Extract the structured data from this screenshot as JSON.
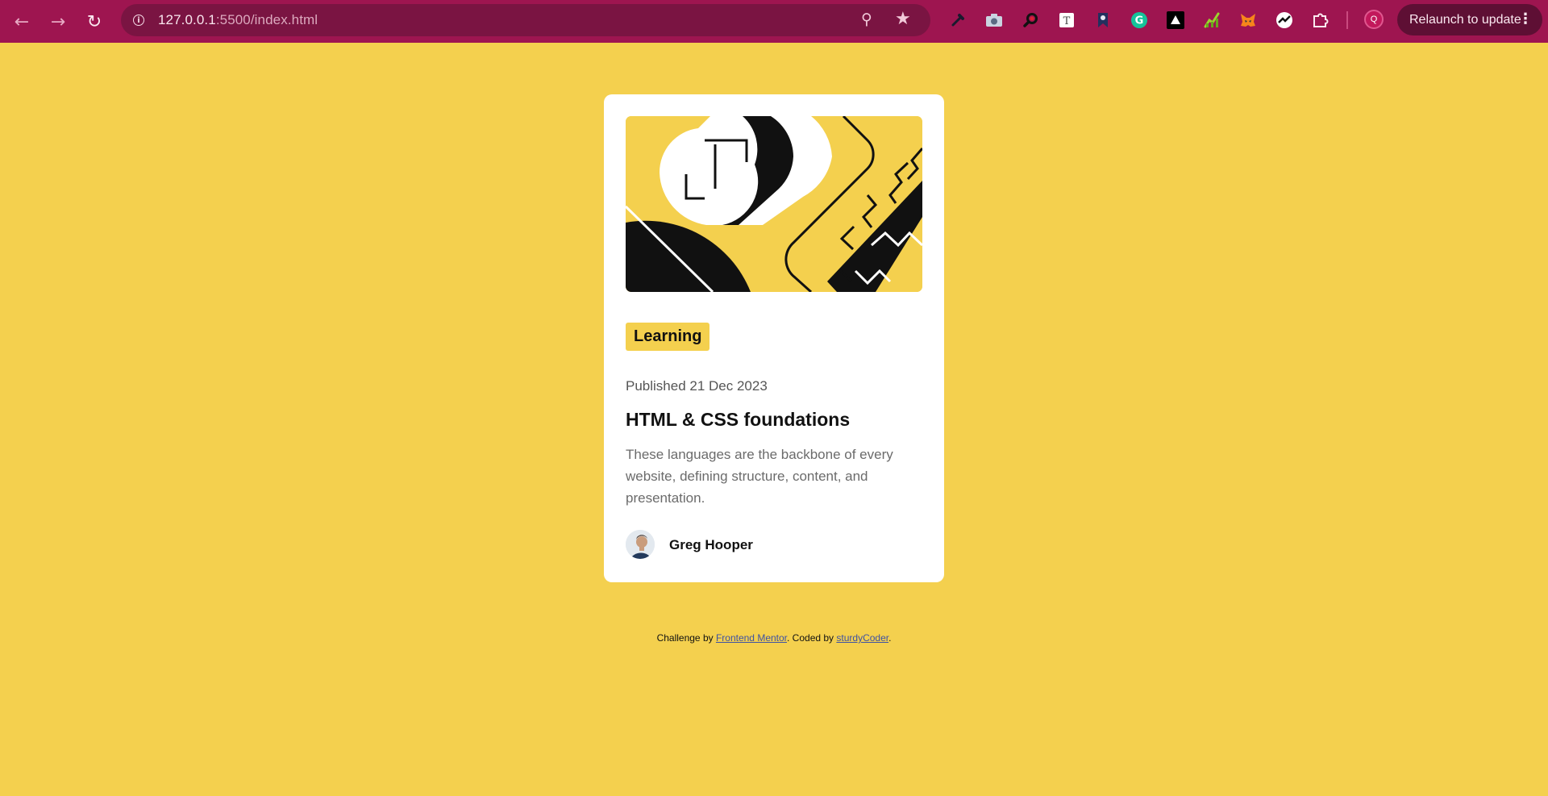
{
  "browser": {
    "url_host": "127.0.0.1",
    "url_rest": ":5500/index.html",
    "relaunch_label": "Relaunch to update",
    "profile_initial": "Q",
    "extensions": [
      "eyedropper-icon",
      "camera-icon",
      "magnifier-icon",
      "text-extension-icon",
      "bookmark-extension-icon",
      "grammarly-icon",
      "triangle-extension-icon",
      "chart-extension-icon",
      "metamask-icon",
      "analytics-extension-icon",
      "puzzle-icon"
    ]
  },
  "card": {
    "tag": "Learning",
    "published": "Published 21 Dec 2023",
    "title": "HTML & CSS foundations",
    "description": "These languages are the backbone of every website, defining structure, content, and presentation.",
    "author": "Greg Hooper"
  },
  "attribution": {
    "prefix": "Challenge by ",
    "link1": "Frontend Mentor",
    "middle": ". Coded by ",
    "link2": "sturdyCoder",
    "suffix": "."
  },
  "colors": {
    "background": "#f4d04e",
    "card": "#ffffff",
    "toolbar": "#9e1550",
    "text_dark": "#111111"
  }
}
